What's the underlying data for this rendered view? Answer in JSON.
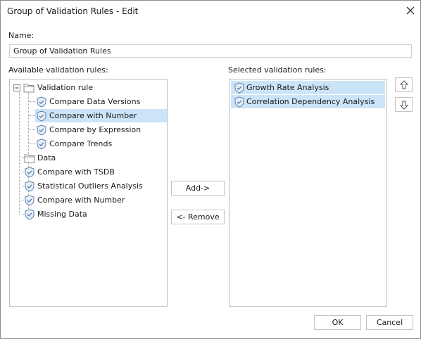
{
  "window": {
    "title": "Group of Validation Rules - Edit"
  },
  "name": {
    "label": "Name:",
    "value": "Group of Validation Rules"
  },
  "available": {
    "label": "Available validation rules:",
    "group_label": "Validation rule",
    "children": [
      "Compare Data Versions",
      "Compare with Number",
      "Compare by Expression",
      "Compare Trends"
    ],
    "items": [
      "Data",
      "Compare with TSDB",
      "Statistical Outliers Analysis",
      "Compare with Number",
      "Missing Data"
    ]
  },
  "selected": {
    "label": "Selected validation rules:",
    "items": [
      "Growth Rate Analysis",
      "Correlation Dependency Analysis"
    ]
  },
  "buttons": {
    "add": "Add->",
    "remove": "<- Remove",
    "ok": "OK",
    "cancel": "Cancel"
  },
  "colors": {
    "selection": "#cce4f7",
    "shield": "#5b7fae",
    "folder": "#d9d9d9"
  }
}
